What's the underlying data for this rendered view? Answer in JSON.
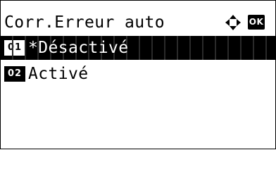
{
  "screen": {
    "title": "Corr.Erreur auto",
    "ok_label": "OK",
    "nav_icon": "four-way-arrow-icon"
  },
  "options": [
    {
      "number": "01",
      "label": "*Désactivé",
      "selected": true
    },
    {
      "number": "02",
      "label": "Activé",
      "selected": false
    }
  ]
}
